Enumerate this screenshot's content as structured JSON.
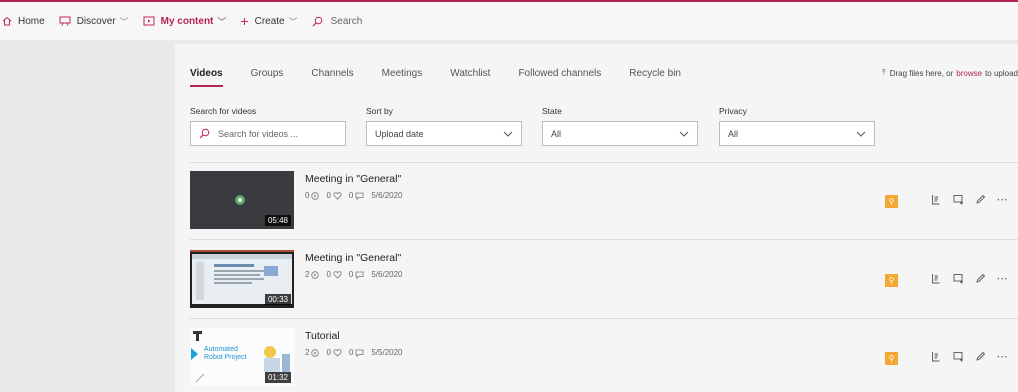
{
  "nav": {
    "home": "Home",
    "discover": "Discover",
    "my_content": "My content",
    "create": "Create",
    "search": "Search"
  },
  "tabs": [
    "Videos",
    "Groups",
    "Channels",
    "Meetings",
    "Watchlist",
    "Followed channels",
    "Recycle bin"
  ],
  "upload": {
    "before": "Drag files here, or",
    "link": "browse",
    "after": "to upload"
  },
  "filters": {
    "search_label": "Search for videos",
    "search_placeholder": "Search for videos ...",
    "sort_label": "Sort by",
    "sort_value": "Upload date",
    "state_label": "State",
    "state_value": "All",
    "privacy_label": "Privacy",
    "privacy_value": "All"
  },
  "videos": [
    {
      "title": "Meeting in \"General\"",
      "views": "0",
      "likes": "0",
      "comments": "0",
      "date": "5/6/2020",
      "duration": "05:48"
    },
    {
      "title": "Meeting in \"General\"",
      "views": "2",
      "likes": "0",
      "comments": "0",
      "date": "5/6/2020",
      "duration": "00:33"
    },
    {
      "title": "Tutorial",
      "views": "2",
      "likes": "0",
      "comments": "0",
      "date": "5/5/2020",
      "duration": "01:32",
      "thumb_text": "Automated Robot Project"
    }
  ],
  "colors": {
    "accent": "#b4235a",
    "badge": "#f3a833"
  }
}
